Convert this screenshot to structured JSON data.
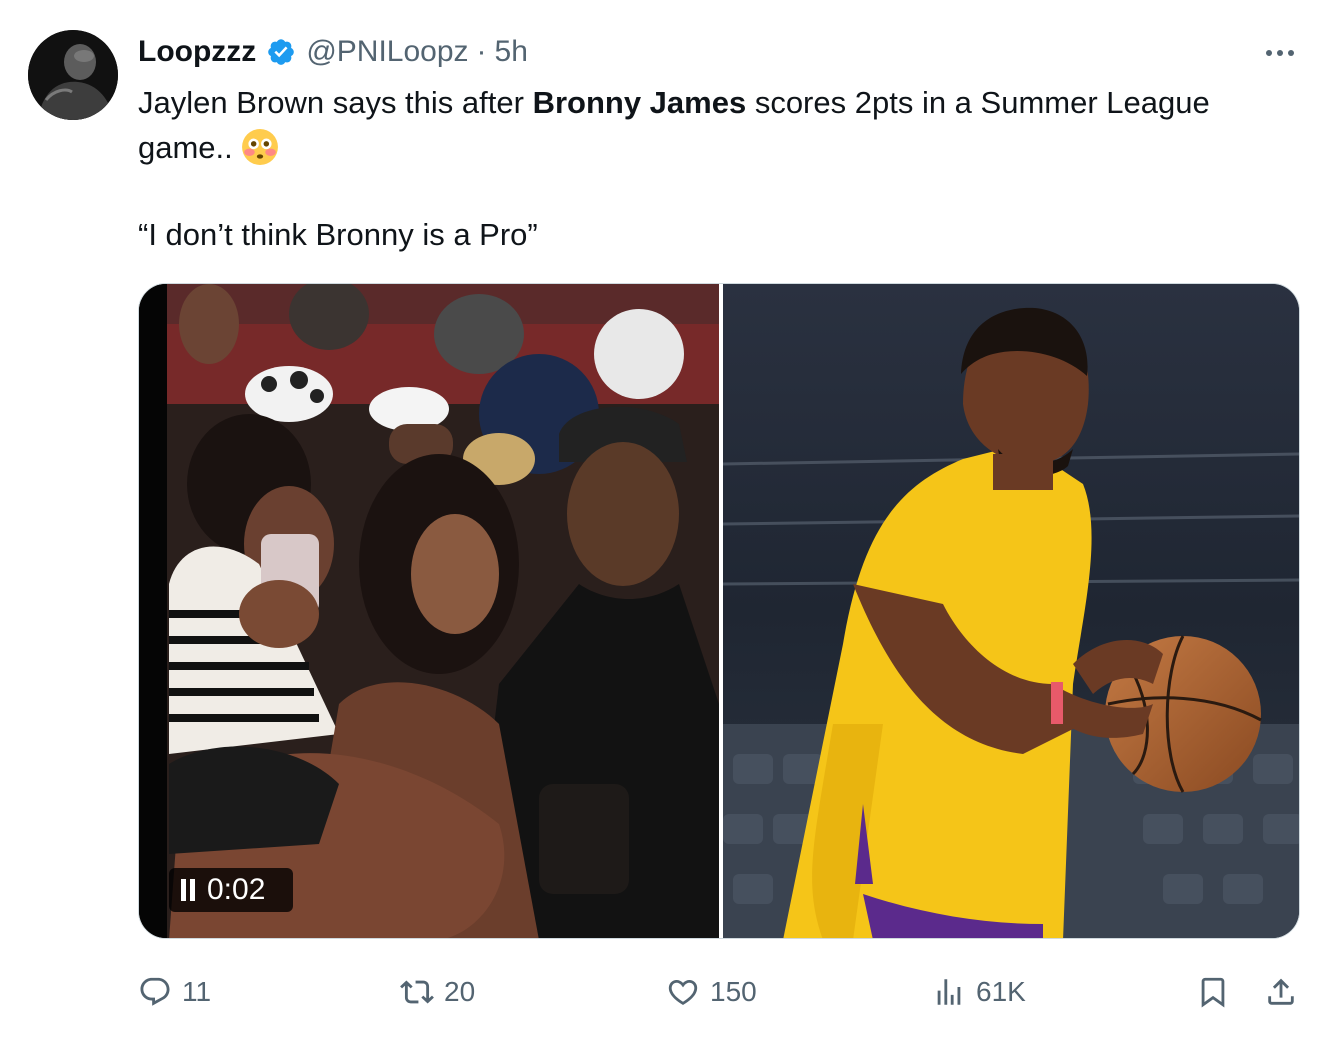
{
  "author": {
    "display_name": "Loopzzz",
    "handle": "@PNILoopz",
    "separator": "·",
    "time": "5h",
    "verified": true,
    "avatar_icon": "avatar-photo"
  },
  "tweet": {
    "text_part1": "Jaylen Brown says this after ",
    "text_bold": "Bronny James",
    "text_part2": " scores 2pts in a Summer League game..",
    "emoji": "flushed-face-emoji",
    "quote": "“I don’t think Bronny is a Pro”"
  },
  "media": {
    "left": {
      "type": "video",
      "description_icon": "crowd-video-thumbnail",
      "playback_time": "0:02",
      "playback_state": "playing"
    },
    "right": {
      "type": "image",
      "description_icon": "player-photo"
    }
  },
  "actions": {
    "reply": {
      "icon": "reply-icon",
      "count": "11"
    },
    "retweet": {
      "icon": "retweet-icon",
      "count": "20"
    },
    "like": {
      "icon": "heart-icon",
      "count": "150"
    },
    "views": {
      "icon": "views-chart-icon",
      "count": "61K"
    },
    "bookmark": {
      "icon": "bookmark-icon"
    },
    "share": {
      "icon": "share-icon"
    }
  },
  "colors": {
    "text_primary": "#0f1419",
    "text_secondary": "#536471",
    "verified_blue": "#1d9bf0",
    "border": "#cfd9de"
  }
}
